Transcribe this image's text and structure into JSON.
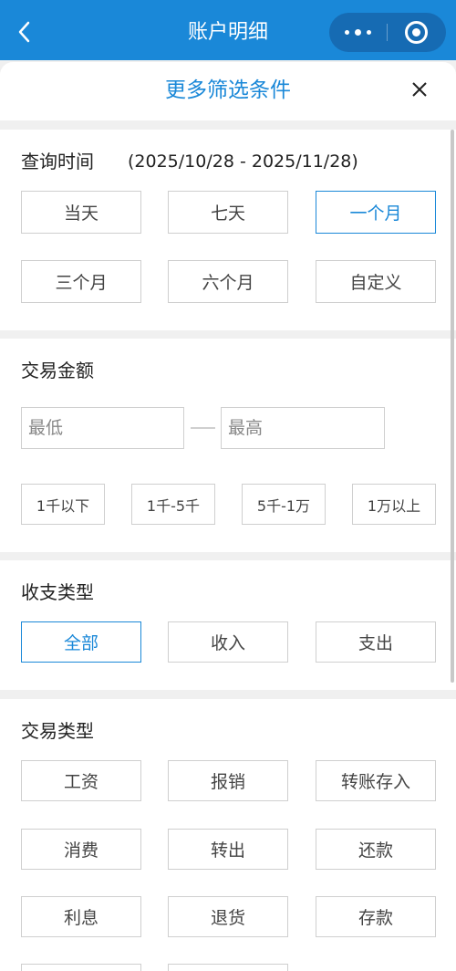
{
  "navbar": {
    "title": "账户明细",
    "back_icon": "chevron-left-icon",
    "more_icon": "more-dots-icon",
    "close_icon": "target-close-icon",
    "bg_color": "#1a88d8"
  },
  "filter_sheet": {
    "title": "更多筛选条件",
    "close_icon": "close-x-icon",
    "accent_color": "#1a88d8"
  },
  "query_time": {
    "label": "查询时间",
    "range": "(2025/10/28 - 2025/11/28)",
    "options": [
      "当天",
      "七天",
      "一个月",
      "三个月",
      "六个月",
      "自定义"
    ],
    "selected": "一个月"
  },
  "amount": {
    "label": "交易金额",
    "min_placeholder": "最低",
    "max_placeholder": "最高",
    "presets": [
      "1千以下",
      "1千-5千",
      "5千-1万",
      "1万以上"
    ]
  },
  "income_type": {
    "label": "收支类型",
    "options": [
      "全部",
      "收入",
      "支出"
    ],
    "selected": "全部"
  },
  "trade_type": {
    "label": "交易类型",
    "options": [
      "工资",
      "报销",
      "转账存入",
      "消费",
      "转出",
      "还款",
      "利息",
      "退货",
      "存款"
    ]
  }
}
